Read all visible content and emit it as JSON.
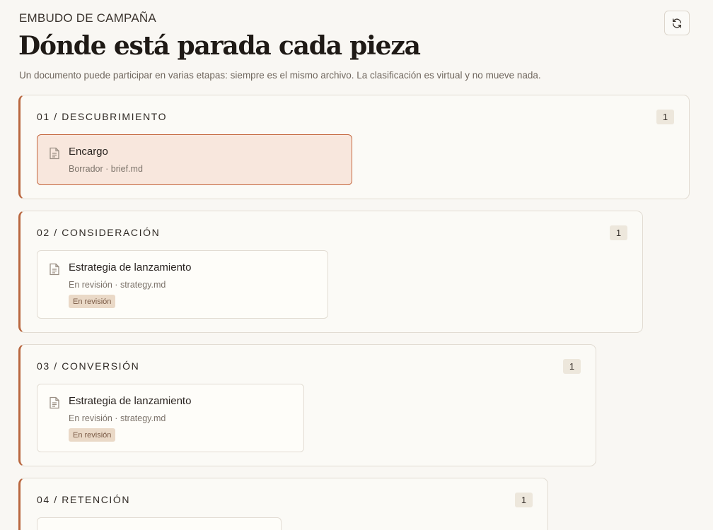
{
  "header": {
    "eyebrow": "EMBUDO DE CAMPAÑA",
    "title": "Dónde está parada cada pieza",
    "subtitle": "Un documento puede participar en varias etapas: siempre es el mismo archivo. La clasificación es virtual y no mueve nada.",
    "refresh_icon": "refresh-icon"
  },
  "colors": {
    "accent": "#b9673f",
    "active_card_bg": "#f8e7dd",
    "badge_bg": "#ead9c7"
  },
  "stages": [
    {
      "label": "01 / DESCUBRIMIENTO",
      "count": "1",
      "card": {
        "title": "Encargo",
        "meta": "Borrador · brief.md",
        "badge": "",
        "active": true
      }
    },
    {
      "label": "02 / CONSIDERACIÓN",
      "count": "1",
      "card": {
        "title": "Estrategia de lanzamiento",
        "meta": "En revisión · strategy.md",
        "badge": "En revisión",
        "active": false
      }
    },
    {
      "label": "03 / CONVERSIÓN",
      "count": "1",
      "card": {
        "title": "Estrategia de lanzamiento",
        "meta": "En revisión · strategy.md",
        "badge": "En revisión",
        "active": false
      }
    },
    {
      "label": "04 / RETENCIÓN",
      "count": "1",
      "card": {
        "title": "",
        "meta": "",
        "badge": "",
        "active": false
      }
    }
  ]
}
